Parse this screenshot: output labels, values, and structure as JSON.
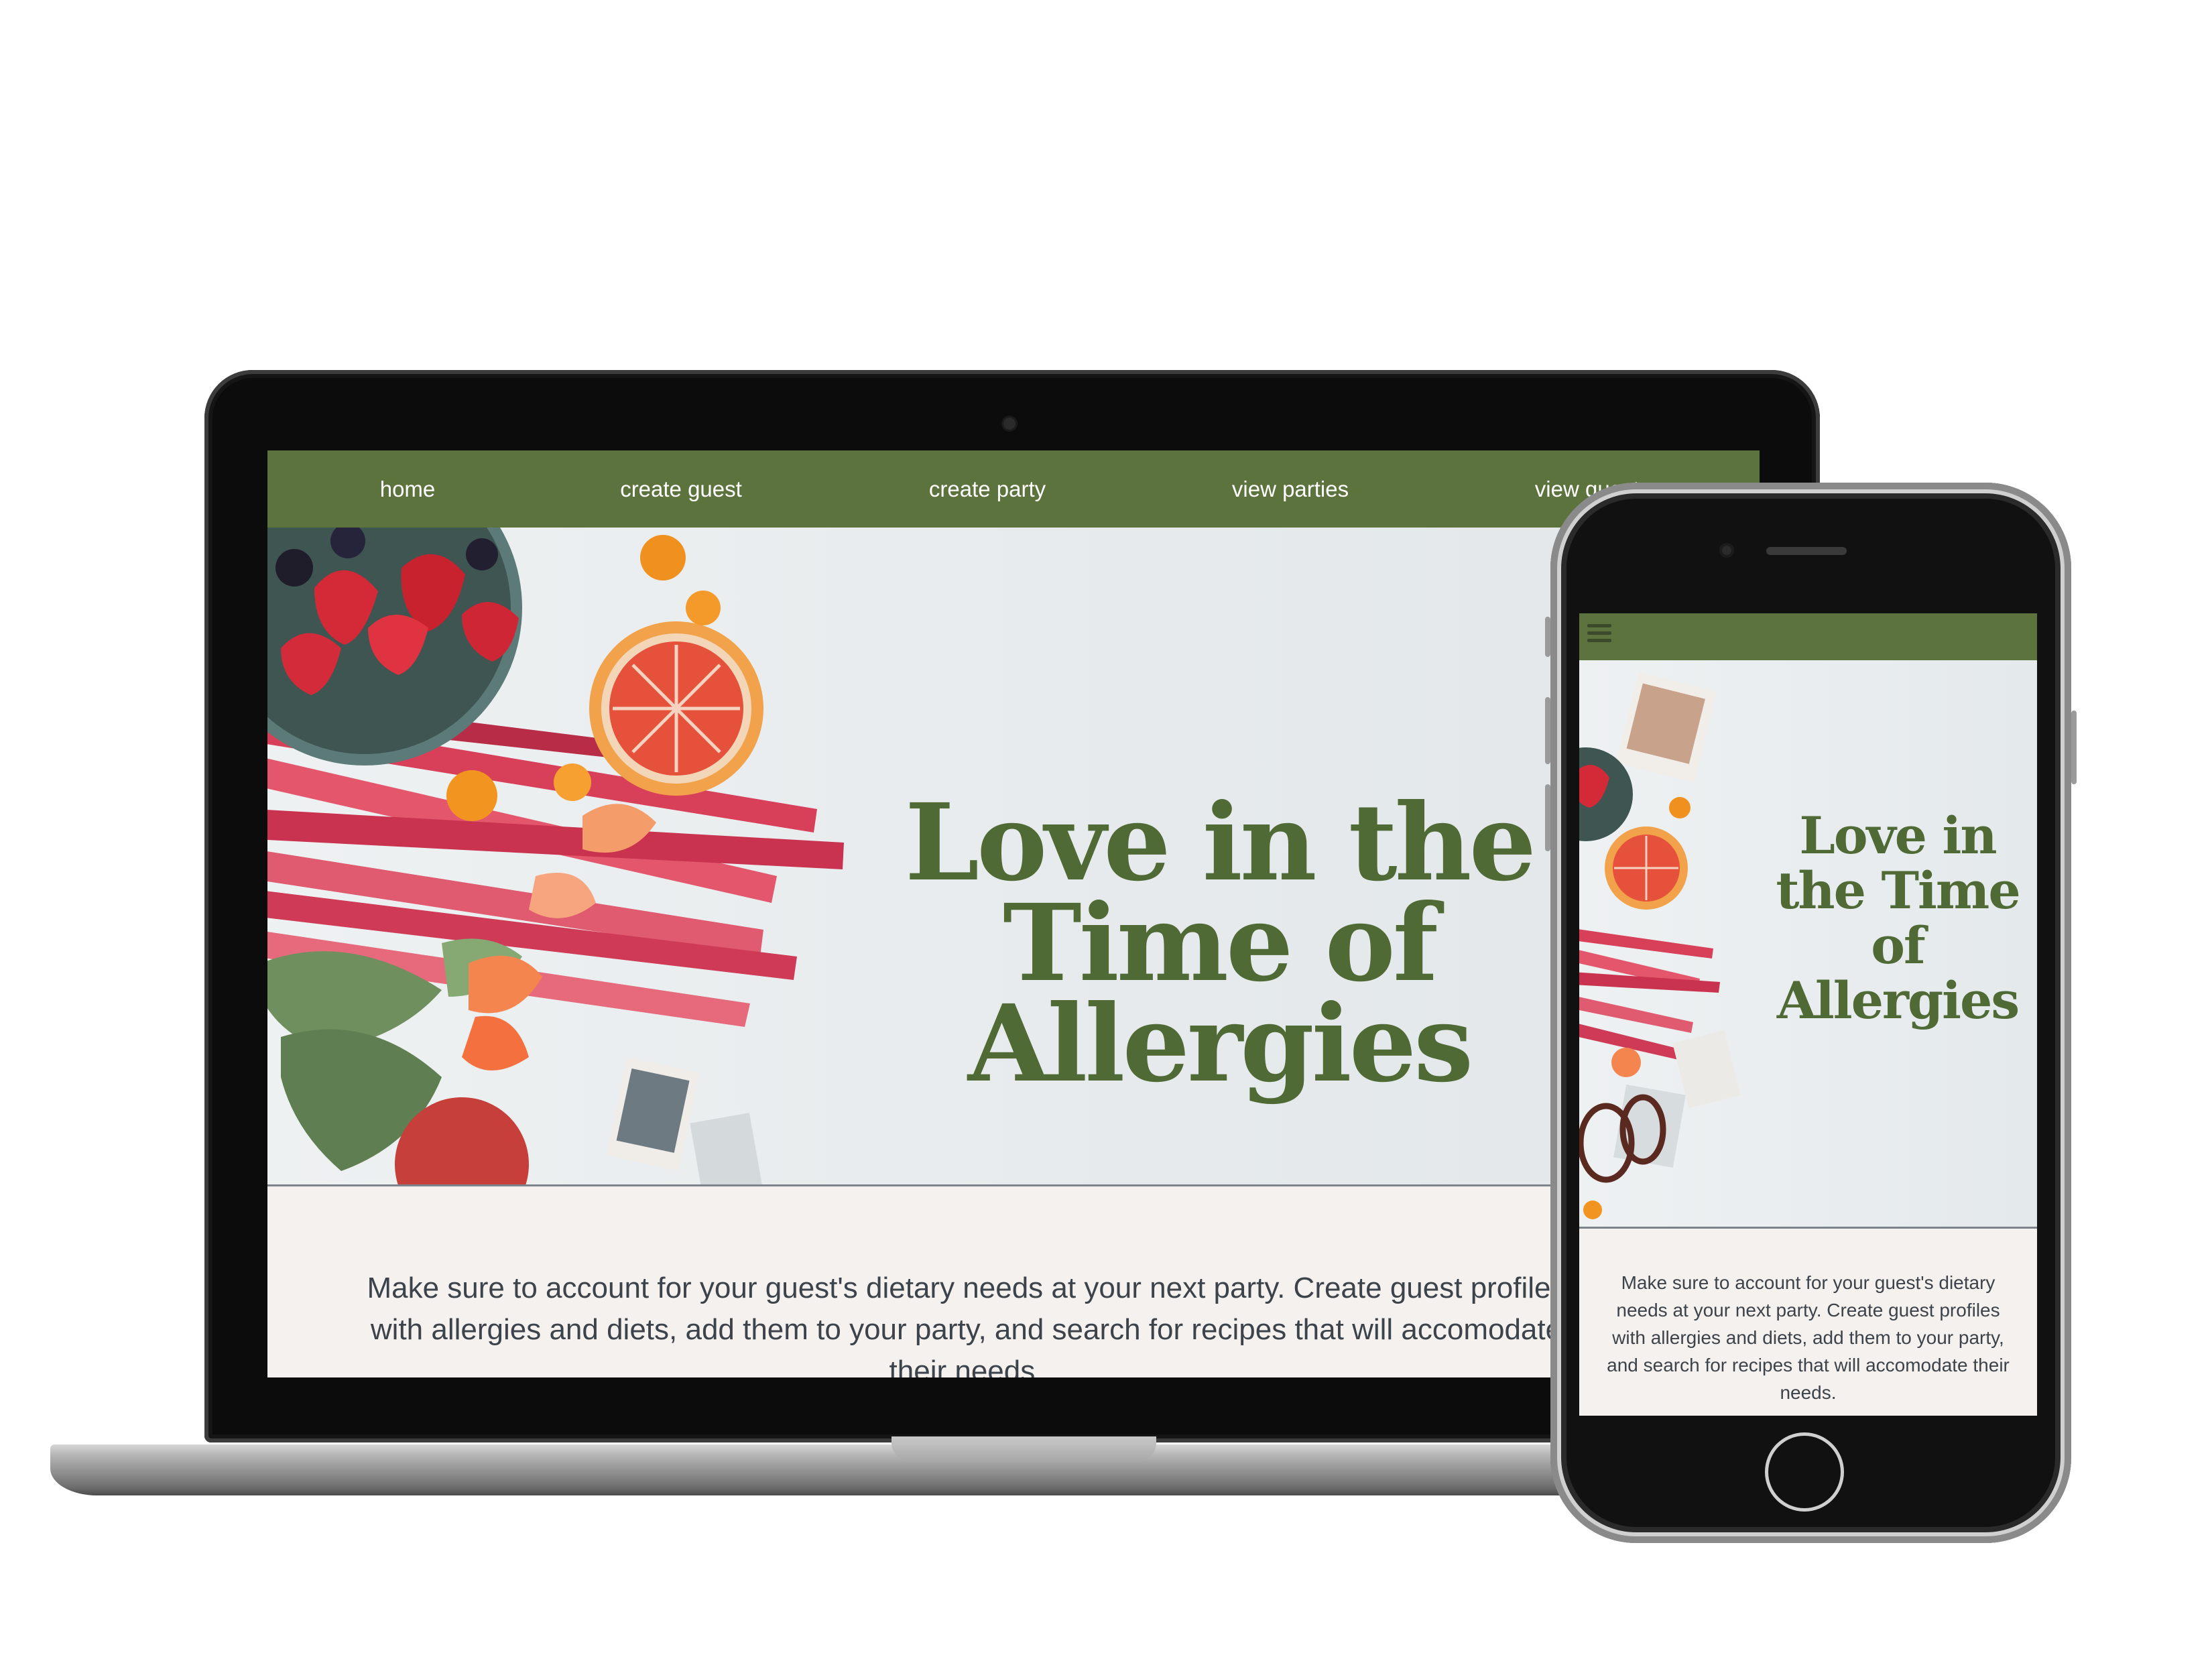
{
  "desktop": {
    "nav": [
      "home",
      "create guest",
      "create party",
      "view parties",
      "view guests"
    ],
    "hero_title": "Love in the Time of Allergies",
    "intro": "Make sure to account for your guest's dietary needs at your next party. Create guest profiles with allergies and diets, add them to your party, and search for recipes that will accomodate their needs."
  },
  "mobile": {
    "menu_icon": "hamburger-menu-icon",
    "hero_title": "Love in the Time of Allergies",
    "intro": "Make sure to account for your guest's dietary needs at your next party. Create guest profiles with allergies and diets, add them to your party, and search for recipes that will accomodate their needs."
  },
  "colors": {
    "nav_green": "#5c733d",
    "title_green": "#4f6a34",
    "body_text": "#3d434a",
    "section_bg": "#f4f1ee"
  }
}
